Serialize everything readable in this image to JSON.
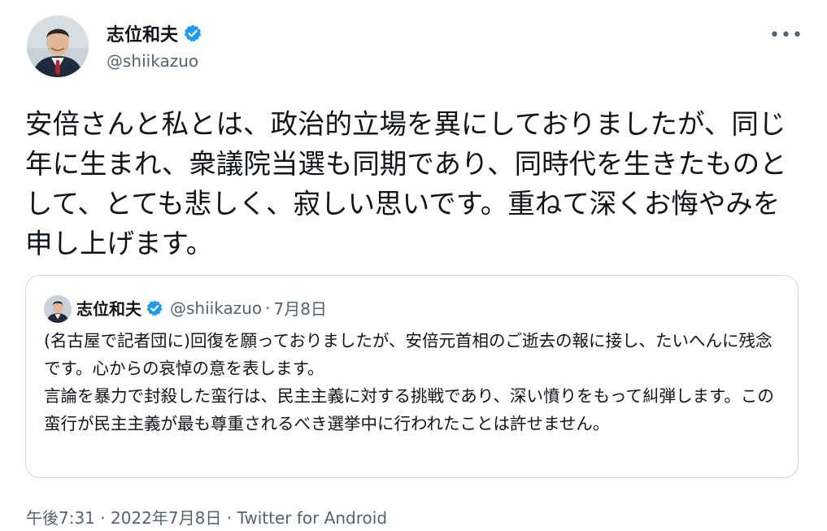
{
  "author": {
    "display_name": "志位和夫",
    "handle": "@shiikazuo",
    "verified": true
  },
  "menu": {
    "more_label": "•••"
  },
  "tweet": {
    "text": "安倍さんと私とは、政治的立場を異にしておりましたが、同じ年に生まれ、衆議院当選も同期であり、同時代を生きたものとして、とても悲しく、寂しい思いです。重ねて深くお悔やみを申し上げます。"
  },
  "quoted_tweet": {
    "display_name": "志位和夫",
    "handle": "@shiikazuo",
    "separator": "·",
    "date": "7月8日",
    "text": "(名古屋で記者団に)回復を願っておりましたが、安倍元首相のご逝去の報に接し、たいへんに残念です。心からの哀悼の意を表します。\n言論を暴力で封殺した蛮行は、民主主義に対する挑戦であり、深い憤りをもって糾弾します。この蛮行が民主主義が最も尊重されるべき選挙中に行われたことは許せません。"
  },
  "meta": {
    "time": "午後7:31",
    "separator": "·",
    "date": "2022年7月8日",
    "source": "Twitter for Android"
  },
  "colors": {
    "text": "#0f1419",
    "secondary": "#536471",
    "verified_blue": "#1d9bf0",
    "border": "#cfd9de"
  },
  "icons": [
    "avatar",
    "verified-badge-icon",
    "more-options-icon"
  ]
}
